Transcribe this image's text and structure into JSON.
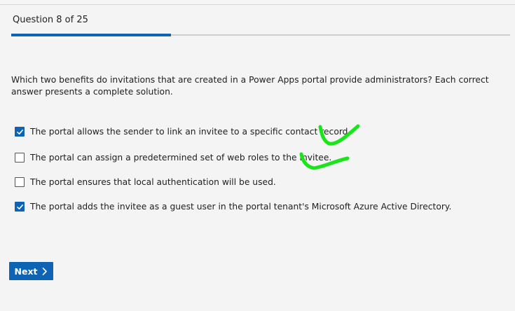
{
  "header": {
    "question_count": "Question 8 of 25",
    "progress_fraction": 0.32
  },
  "question": {
    "prompt": "Which two benefits do invitations that are created in a Power Apps portal provide administrators? Each correct answer presents a complete solution."
  },
  "options": [
    {
      "label": "The portal allows the sender to link an invitee to a specific contact record.",
      "checked": true
    },
    {
      "label": "The portal can assign a predetermined set of web roles to the invitee.",
      "checked": false
    },
    {
      "label": "The portal ensures that local authentication will be used.",
      "checked": false
    },
    {
      "label": "The portal adds the invitee as a guest user in the portal tenant's Microsoft Azure Active Directory.",
      "checked": true
    }
  ],
  "footer": {
    "next_label": "Next"
  },
  "colors": {
    "accent": "#0f63b5",
    "annotation": "#19e619"
  }
}
